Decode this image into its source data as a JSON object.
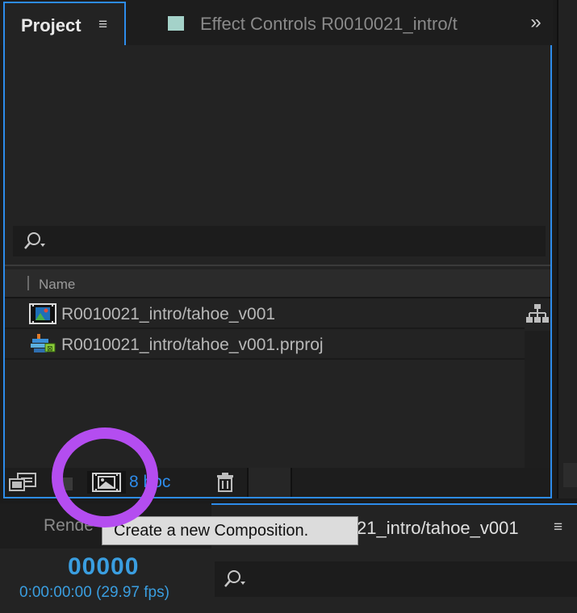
{
  "tabs": {
    "project_label": "Project",
    "project_menu": "≡",
    "effect_label": "Effect Controls R0010021_intro/t",
    "effect_swatch_color": "#a4d2c9",
    "overflow": "»"
  },
  "project_panel": {
    "search_placeholder": "",
    "column_name": "Name",
    "items": [
      {
        "name": "R0010021_intro/tahoe_v001",
        "icon": "composition-icon"
      },
      {
        "name": "R0010021_intro/tahoe_v001.prproj",
        "icon": "premiere-project-icon"
      }
    ],
    "bit_depth": "8 bpc"
  },
  "bottom": {
    "render_tab": "Rende",
    "sequence_tab": "21_intro/tahoe_v001",
    "sequence_menu": "≡",
    "timecode": "00000",
    "timecode_sub": "0:00:00:00 (29.97 fps)"
  },
  "tooltip": "Create a new Composition.",
  "colors": {
    "accent": "#2d8ceb",
    "timecode": "#3a9ee0",
    "highlight": "#b44df0"
  }
}
